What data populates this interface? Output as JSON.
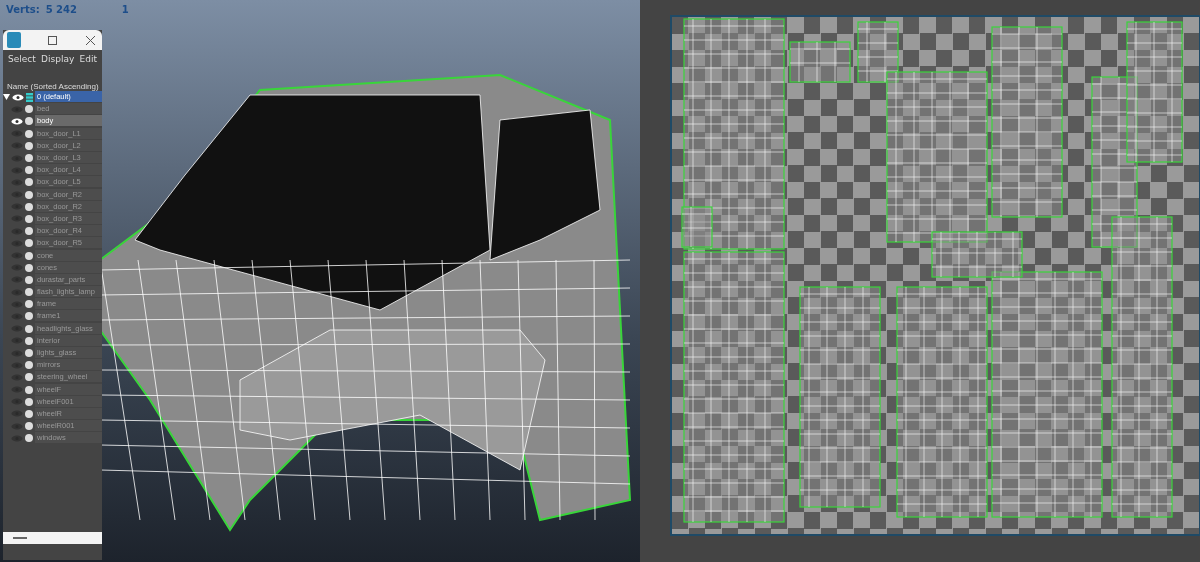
{
  "viewport": {
    "stats": [
      {
        "label": "Verts:",
        "value": "5 242",
        "extra": "1"
      }
    ]
  },
  "layer_window": {
    "menu": [
      "Select",
      "Display",
      "Edit"
    ],
    "header": "Name (Sorted Ascending)",
    "root": {
      "label": "0 (default)",
      "selected": true,
      "expanded": true,
      "visible": true,
      "children": [
        {
          "label": "bed",
          "selected": false,
          "visible": false
        },
        {
          "label": "body",
          "selected": true,
          "visible": true
        },
        {
          "label": "box_door_L1",
          "selected": false,
          "visible": false
        },
        {
          "label": "box_door_L2",
          "selected": false,
          "visible": false
        },
        {
          "label": "box_door_L3",
          "selected": false,
          "visible": false
        },
        {
          "label": "box_door_L4",
          "selected": false,
          "visible": false
        },
        {
          "label": "box_door_L5",
          "selected": false,
          "visible": false
        },
        {
          "label": "box_door_R2",
          "selected": false,
          "visible": false
        },
        {
          "label": "box_door_R2",
          "selected": false,
          "visible": false
        },
        {
          "label": "box_door_R3",
          "selected": false,
          "visible": false
        },
        {
          "label": "box_door_R4",
          "selected": false,
          "visible": false
        },
        {
          "label": "box_door_R5",
          "selected": false,
          "visible": false
        },
        {
          "label": "cone",
          "selected": false,
          "visible": false
        },
        {
          "label": "cones",
          "selected": false,
          "visible": false
        },
        {
          "label": "durastar_parts",
          "selected": false,
          "visible": false
        },
        {
          "label": "flash_lights_lamp",
          "selected": false,
          "visible": false
        },
        {
          "label": "frame",
          "selected": false,
          "visible": false
        },
        {
          "label": "frame1",
          "selected": false,
          "visible": false
        },
        {
          "label": "headlights_glass",
          "selected": false,
          "visible": false
        },
        {
          "label": "interior",
          "selected": false,
          "visible": false
        },
        {
          "label": "lights_glass",
          "selected": false,
          "visible": false
        },
        {
          "label": "mirrors",
          "selected": false,
          "visible": false
        },
        {
          "label": "steering_wheel",
          "selected": false,
          "visible": false
        },
        {
          "label": "wheelF",
          "selected": false,
          "visible": false
        },
        {
          "label": "wheelF001",
          "selected": false,
          "visible": false
        },
        {
          "label": "wheelR",
          "selected": false,
          "visible": false
        },
        {
          "label": "wheelR001",
          "selected": false,
          "visible": false
        },
        {
          "label": "windows",
          "selected": false,
          "visible": false
        }
      ]
    }
  }
}
